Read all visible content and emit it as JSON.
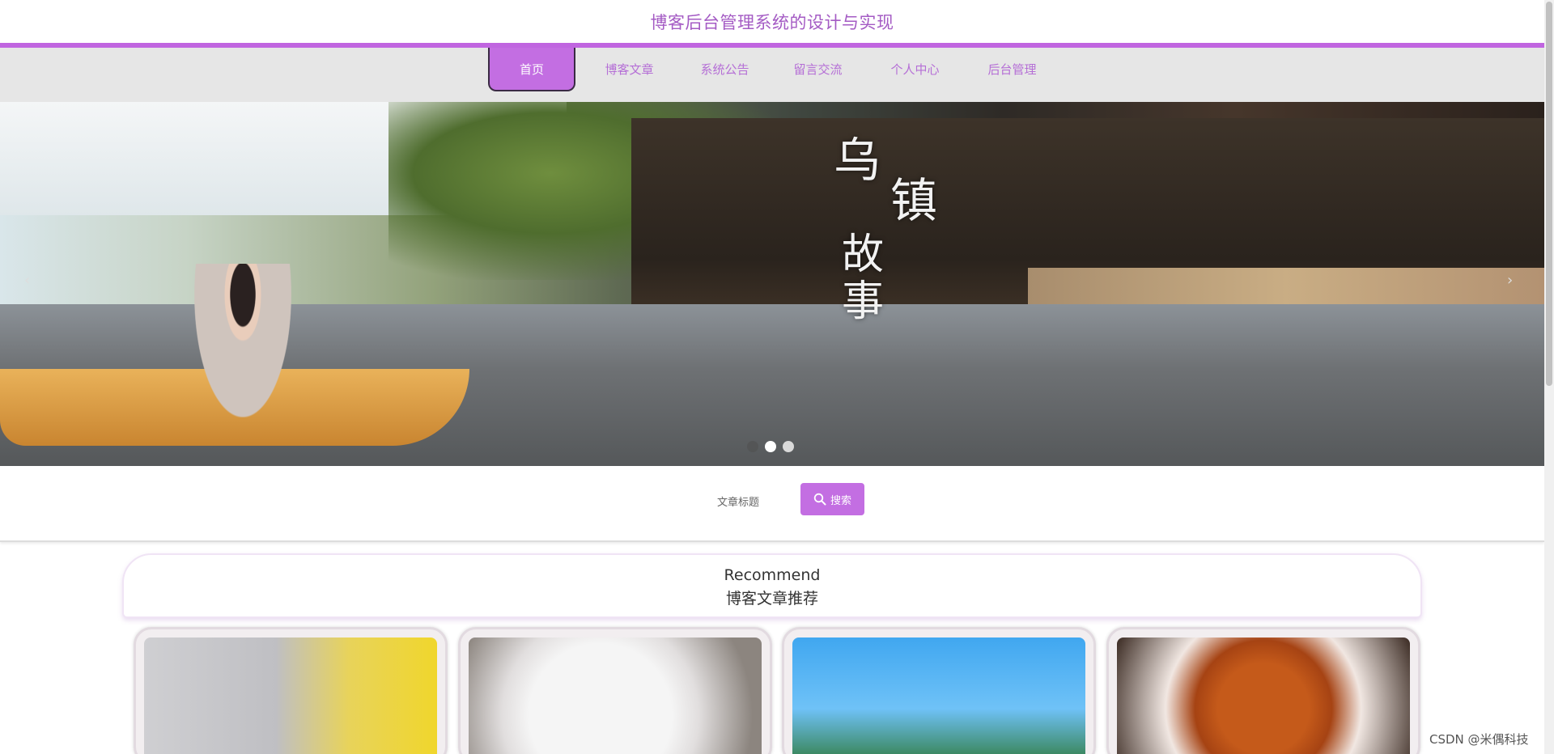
{
  "header": {
    "title": "博客后台管理系统的设计与实现"
  },
  "nav": {
    "items": [
      {
        "label": "首页",
        "active": true
      },
      {
        "label": "博客文章"
      },
      {
        "label": "系统公告"
      },
      {
        "label": "留言交流"
      },
      {
        "label": "个人中心"
      },
      {
        "label": "后台管理"
      }
    ]
  },
  "banner": {
    "text_line1": "乌",
    "text_line2": "镇",
    "text_line3": "故事",
    "prev_arrow": "‹",
    "next_arrow": "›",
    "slides": 3,
    "active_slide": 2
  },
  "search": {
    "field_label": "文章标题",
    "button_label": "搜索",
    "button_icon": "search-icon"
  },
  "recommend": {
    "title_en": "Recommend",
    "title_cn": "博客文章推荐",
    "cards": [
      {
        "image": "grey-kitten"
      },
      {
        "image": "white-kitten"
      },
      {
        "image": "mickey-minnie-castle"
      },
      {
        "image": "braised-pork-dish"
      }
    ]
  },
  "watermark": "CSDN @米偶科技",
  "colors": {
    "accent": "#c36ee2",
    "title": "#a45bc4",
    "nav_bg": "#e6e6e6"
  }
}
